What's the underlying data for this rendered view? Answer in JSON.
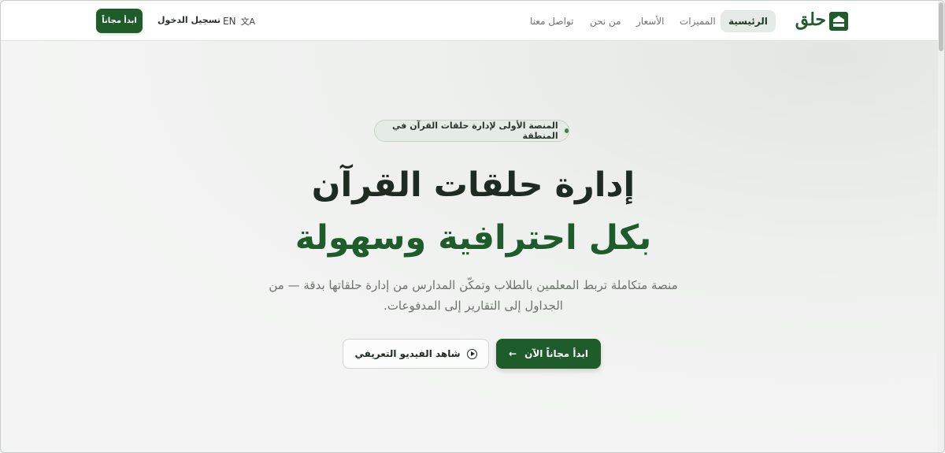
{
  "header": {
    "logo_text": "حلق",
    "nav": [
      {
        "label": "الرئيسية",
        "active": true
      },
      {
        "label": "المميزات",
        "active": false
      },
      {
        "label": "الأسعار",
        "active": false
      },
      {
        "label": "من نحن",
        "active": false
      },
      {
        "label": "تواصل معنا",
        "active": false
      }
    ],
    "lang_label": "EN",
    "lang_icon": "translate-icon",
    "login_label": "تسجيل الدخول",
    "cta_label": "ابدأ مجاناً"
  },
  "hero": {
    "badge": "المنصة الأولى لإدارة حلقات القرآن في المنطقة",
    "title_line1": "إدارة حلقات القرآن",
    "title_line2": "بكل احترافية وسهولة",
    "subtitle": "منصة متكاملة تربط المعلمين بالطلاب وتمكّن المدارس من إدارة حلقاتها بدقة — من الجداول إلى التقارير إلى المدفوعات.",
    "primary_cta": "ابدأ مجاناً الآن",
    "primary_icon": "arrow-left-icon",
    "secondary_cta": "شاهد الفيديو التعريفي",
    "secondary_icon": "play-circle-icon"
  },
  "colors": {
    "brand": "#1e5c2c",
    "text": "#1f2a22",
    "muted": "#6d726d"
  }
}
